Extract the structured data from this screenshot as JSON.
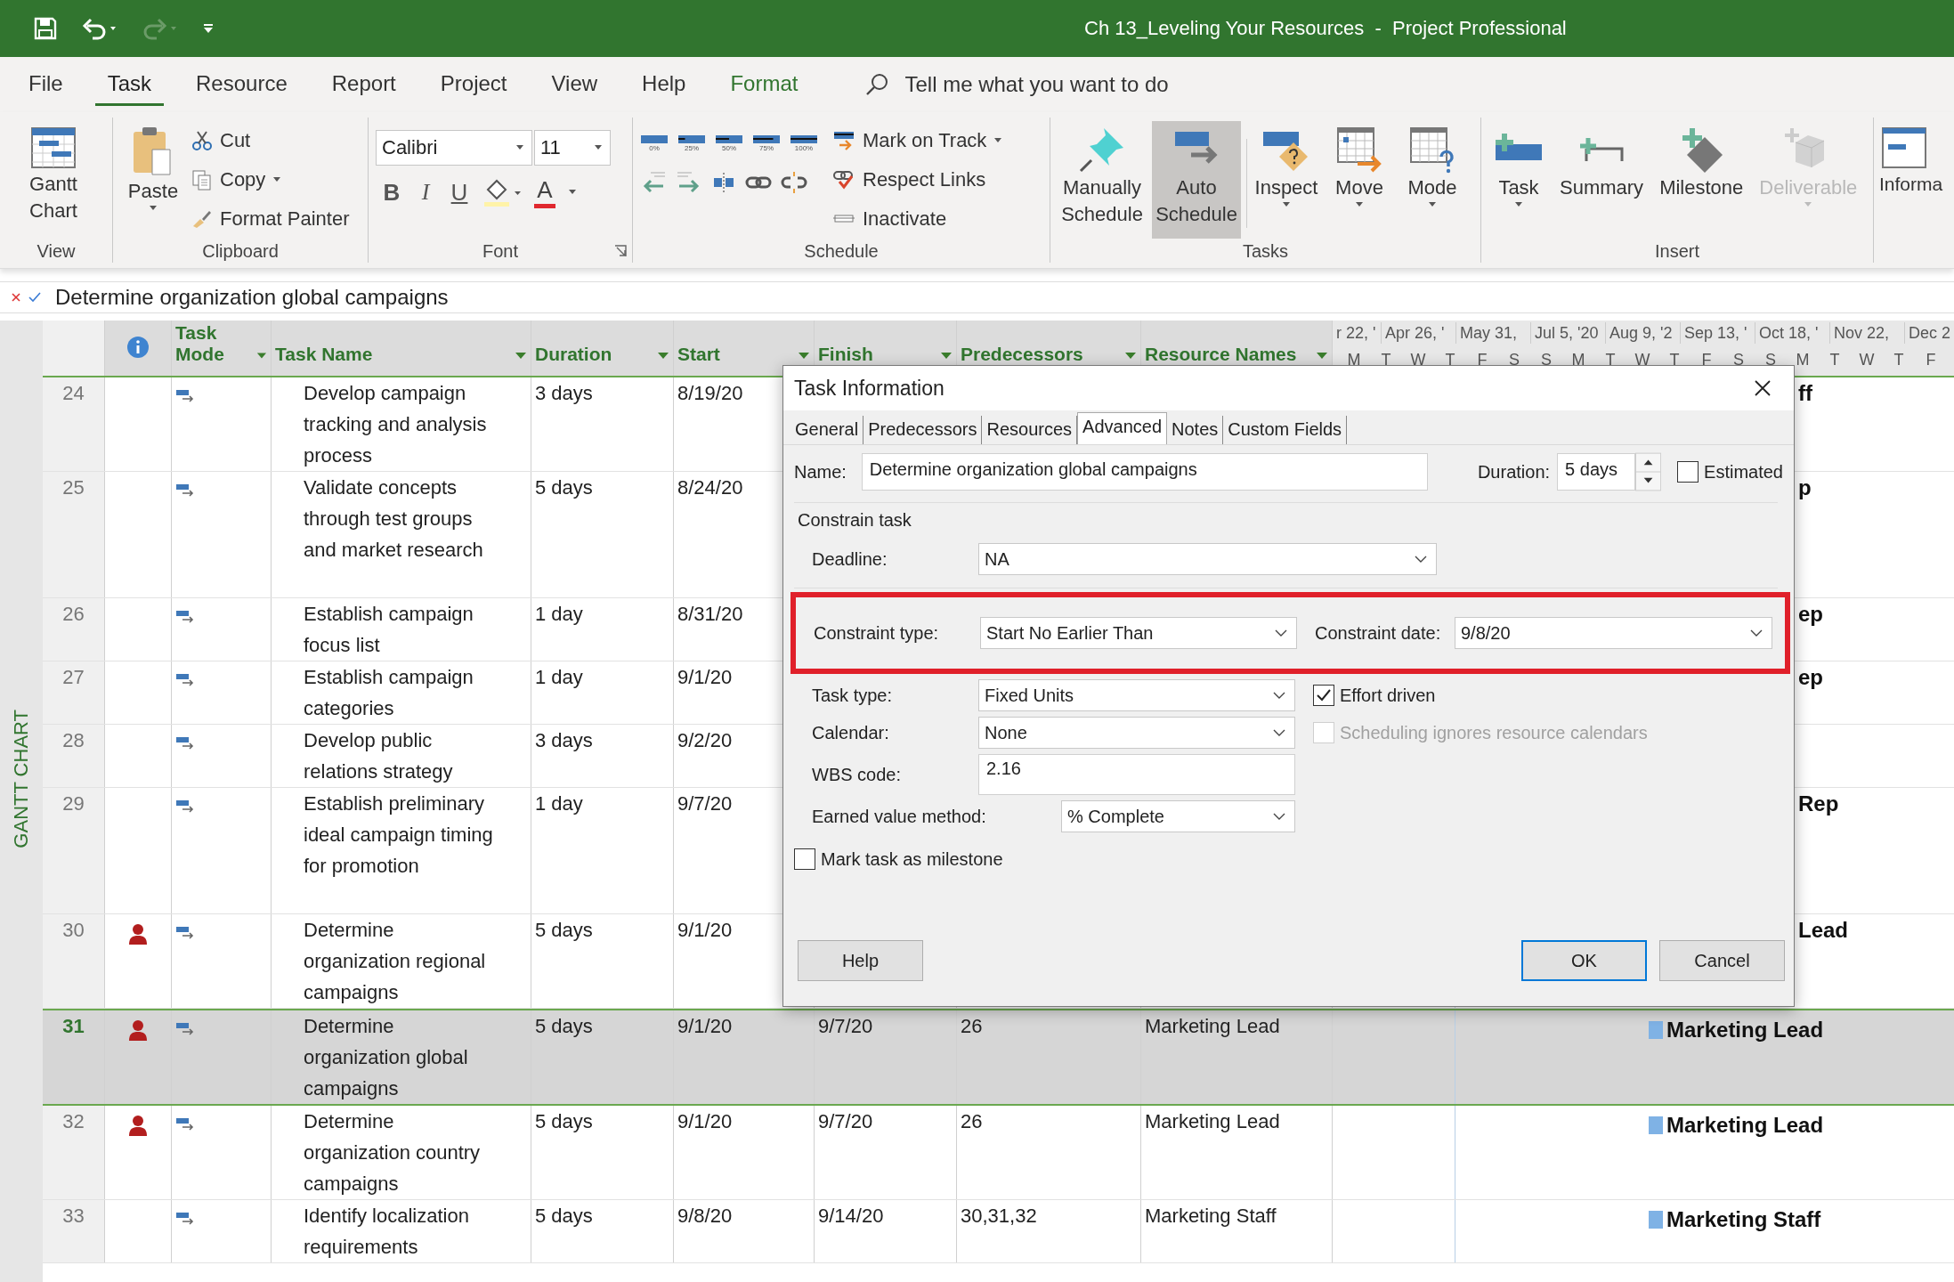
{
  "title_bar": {
    "title": "Ch 13_Leveling Your Resources  -  Project Professional"
  },
  "menu_tabs": [
    {
      "label": "File",
      "selected": false,
      "kind": "plain"
    },
    {
      "label": "Task",
      "selected": true,
      "kind": "plain"
    },
    {
      "label": "Resource",
      "selected": false,
      "kind": "plain"
    },
    {
      "label": "Report",
      "selected": false,
      "kind": "plain"
    },
    {
      "label": "Project",
      "selected": false,
      "kind": "plain"
    },
    {
      "label": "View",
      "selected": false,
      "kind": "plain"
    },
    {
      "label": "Help",
      "selected": false,
      "kind": "plain"
    },
    {
      "label": "Format",
      "selected": false,
      "kind": "contextual"
    }
  ],
  "search": {
    "placeholder": "Tell me what you want to do"
  },
  "ribbon": {
    "view": {
      "label": "View",
      "gantt_chart": "Gantt Chart"
    },
    "clipboard": {
      "label": "Clipboard",
      "paste": "Paste",
      "cut": "Cut",
      "copy": "Copy",
      "format_painter": "Format Painter"
    },
    "font": {
      "label": "Font",
      "family": "Calibri",
      "size": "11",
      "bold": "B",
      "italic": "I",
      "underline": "U",
      "font_color": "A"
    },
    "schedule": {
      "label": "Schedule",
      "percents": [
        "0%",
        "25%",
        "50%",
        "75%",
        "100%"
      ],
      "mark_on_track": "Mark on Track",
      "respect_links": "Respect Links",
      "inactivate": "Inactivate"
    },
    "tasks": {
      "label": "Tasks",
      "modes": [
        {
          "label": "Manually Schedule",
          "selected": false
        },
        {
          "label": "Auto Schedule",
          "selected": true
        }
      ],
      "tools": [
        "Inspect",
        "Move",
        "Mode"
      ]
    },
    "insert": {
      "label": "Insert",
      "buttons": [
        {
          "label": "Task",
          "disabled": false
        },
        {
          "label": "Summary",
          "disabled": false
        },
        {
          "label": "Milestone",
          "disabled": false
        },
        {
          "label": "Deliverable",
          "disabled": true
        }
      ]
    },
    "information": {
      "label": "Informa"
    }
  },
  "entry_bar": {
    "value": "Determine organization global campaigns"
  },
  "view_label": "GANTT CHART",
  "table": {
    "columns": [
      "Task Mode",
      "Task Name",
      "Duration",
      "Start",
      "Finish",
      "Predecessors",
      "Resource Names"
    ],
    "rows": [
      {
        "id": "24",
        "indicator": false,
        "selected": false,
        "name": "Develop campaign tracking and analysis process",
        "duration": "3 days",
        "start": "8/19/20",
        "bar": false,
        "gantt_label": "ff"
      },
      {
        "id": "25",
        "indicator": false,
        "selected": false,
        "name": "Validate concepts through test groups and market research",
        "duration": "5 days",
        "start": "8/24/20",
        "bar": false,
        "gantt_label": "p"
      },
      {
        "id": "26",
        "indicator": false,
        "selected": false,
        "name": "Establish campaign focus list",
        "duration": "1 day",
        "start": "8/31/20",
        "bar": false,
        "gantt_label": "ep"
      },
      {
        "id": "27",
        "indicator": false,
        "selected": false,
        "name": "Establish campaign categories",
        "duration": "1 day",
        "start": "9/1/20",
        "bar": false,
        "gantt_label": "ep"
      },
      {
        "id": "28",
        "indicator": false,
        "selected": false,
        "name": "Develop public relations strategy",
        "duration": "3 days",
        "start": "9/2/20",
        "bar": false
      },
      {
        "id": "29",
        "indicator": false,
        "selected": false,
        "name": "Establish preliminary ideal campaign timing for promotion",
        "duration": "1 day",
        "start": "9/7/20",
        "bar": false,
        "gantt_label": "Rep"
      },
      {
        "id": "30",
        "indicator": true,
        "selected": false,
        "name": "Determine organization regional campaigns",
        "duration": "5 days",
        "start": "9/1/20",
        "bar": false,
        "gantt_label": "Lead"
      },
      {
        "id": "31",
        "indicator": true,
        "selected": true,
        "name": "Determine organization global campaigns",
        "duration": "5 days",
        "start": "9/1/20",
        "finish": "9/7/20",
        "predecessors": "26",
        "resource": "Marketing Lead",
        "bar": true,
        "gantt_label": "Marketing Lead"
      },
      {
        "id": "32",
        "indicator": true,
        "selected": false,
        "name": "Determine organization country campaigns",
        "duration": "5 days",
        "start": "9/1/20",
        "finish": "9/7/20",
        "predecessors": "26",
        "resource": "Marketing Lead",
        "bar": true,
        "gantt_label": "Marketing Lead"
      },
      {
        "id": "33",
        "indicator": false,
        "selected": false,
        "name": "Identify localization requirements",
        "duration": "5 days",
        "start": "9/8/20",
        "finish": "9/14/20",
        "predecessors": "30,31,32",
        "resource": "Marketing Staff",
        "bar": true,
        "gantt_label": "Marketing Staff"
      }
    ]
  },
  "timescale": {
    "top": [
      "r 22, '",
      "Apr 26, '",
      "May 31,",
      "Jul 5, '20",
      "Aug 9, '2",
      "Sep 13, '",
      "Oct 18, '",
      "Nov 22,",
      "Dec 2"
    ],
    "days": [
      "M",
      "T",
      "W",
      "T",
      "F",
      "S",
      "S",
      "M",
      "T",
      "W",
      "T",
      "F",
      "S",
      "S",
      "M",
      "T",
      "W",
      "T",
      "F"
    ]
  },
  "dialog": {
    "title": "Task Information",
    "tabs": [
      {
        "label": "General",
        "selected": false
      },
      {
        "label": "Predecessors",
        "selected": false
      },
      {
        "label": "Resources",
        "selected": false
      },
      {
        "label": "Advanced",
        "selected": true
      },
      {
        "label": "Notes",
        "selected": false
      },
      {
        "label": "Custom Fields",
        "selected": false
      }
    ],
    "name_label": "Name:",
    "name": "Determine organization global campaigns",
    "duration_label": "Duration:",
    "duration": "5 days",
    "estimated": {
      "label": "Estimated",
      "checked": false
    },
    "constrain_title": "Constrain task",
    "deadline": {
      "label": "Deadline:",
      "value": "NA"
    },
    "constraint": {
      "highlighted": true,
      "type_label": "Constraint type:",
      "type": "Start No Earlier Than",
      "date_label": "Constraint date:",
      "date": "9/8/20"
    },
    "task_type": {
      "label": "Task type:",
      "value": "Fixed Units"
    },
    "effort_driven": {
      "label": "Effort driven",
      "checked": true,
      "disabled": false
    },
    "calendar": {
      "label": "Calendar:",
      "value": "None"
    },
    "ignores_calendars": {
      "label": "Scheduling ignores resource calendars",
      "checked": false,
      "disabled": true
    },
    "wbs": {
      "label": "WBS code:",
      "value": "2.16"
    },
    "earned_value": {
      "label": "Earned value method:",
      "value": "% Complete"
    },
    "milestone": {
      "label": "Mark task as milestone",
      "checked": false
    },
    "buttons": [
      {
        "label": "Help",
        "kind": "plain"
      },
      {
        "label": "OK",
        "kind": "default"
      },
      {
        "label": "Cancel",
        "kind": "plain"
      }
    ]
  }
}
